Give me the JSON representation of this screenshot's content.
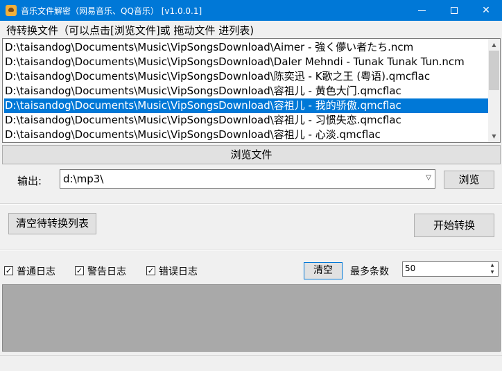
{
  "window": {
    "title": "音乐文件解密（网易音乐、QQ音乐）   [v1.0.0.1]",
    "minimize": "—",
    "maximize": "☐",
    "close": "✕"
  },
  "files": {
    "header": "待转换文件（可以点击[浏览文件]或 拖动文件 进列表)",
    "items": [
      "D:\\taisandog\\Documents\\Music\\VipSongsDownload\\Aimer - 強く儚い者たち.ncm",
      "D:\\taisandog\\Documents\\Music\\VipSongsDownload\\Daler Mehndi - Tunak Tunak Tun.ncm",
      "D:\\taisandog\\Documents\\Music\\VipSongsDownload\\陈奕迅 - K歌之王 (粤语).qmcflac",
      "D:\\taisandog\\Documents\\Music\\VipSongsDownload\\容祖儿 - 黄色大门.qmcflac",
      "D:\\taisandog\\Documents\\Music\\VipSongsDownload\\容祖儿 - 我的骄傲.qmcflac",
      "D:\\taisandog\\Documents\\Music\\VipSongsDownload\\容祖儿 - 习惯失恋.qmcflac",
      "D:\\taisandog\\Documents\\Music\\VipSongsDownload\\容祖儿 - 心淡.qmcflac"
    ],
    "selected_index": 4,
    "browse_files_label": "浏览文件"
  },
  "output": {
    "label": "输出:",
    "path": "d:\\mp3\\",
    "browse_label": "浏览"
  },
  "actions": {
    "clear_list_label": "清空待转换列表",
    "start_label": "开始转换"
  },
  "log": {
    "normal_label": "普通日志",
    "normal_checked": true,
    "warning_label": "警告日志",
    "warning_checked": true,
    "error_label": "错误日志",
    "error_checked": true,
    "clear_label": "清空",
    "max_count_label": "最多条数",
    "max_count_value": "50",
    "check_mark": "✓"
  },
  "colors": {
    "accent": "#0078d7",
    "log_background": "#a9a9a9"
  }
}
